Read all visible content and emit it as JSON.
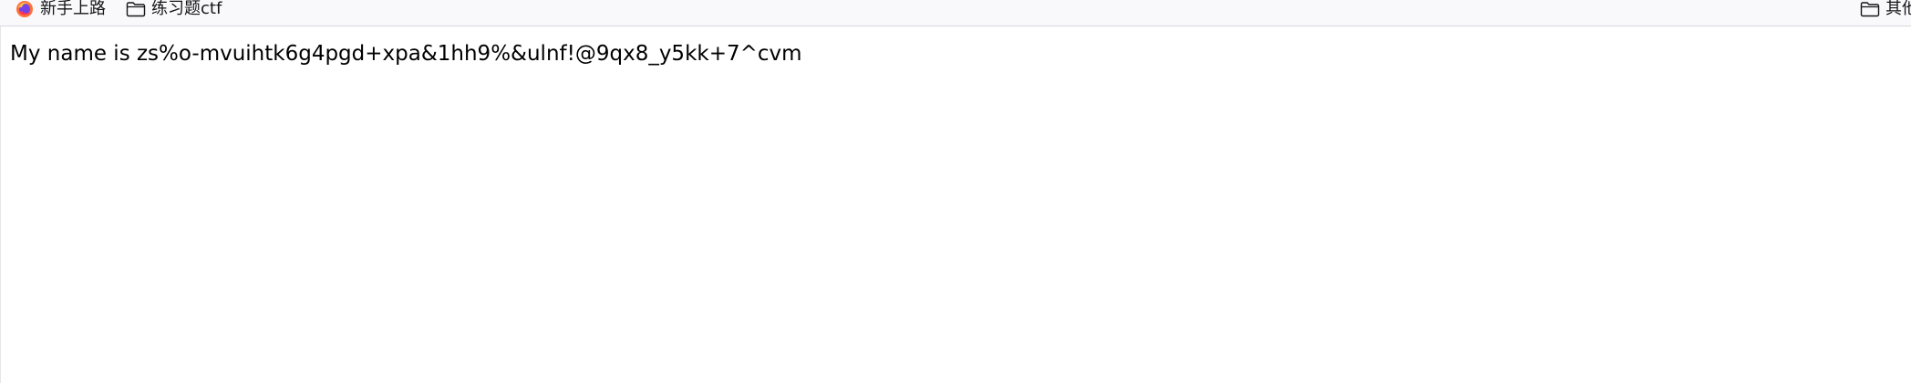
{
  "bookmarks_bar": {
    "items": [
      {
        "label": "新手上路",
        "icon": "firefox-icon"
      },
      {
        "label": "练习题ctf",
        "icon": "folder-icon"
      },
      {
        "label": "其他",
        "icon": "folder-icon"
      }
    ]
  },
  "page": {
    "text": "My name is zs%o-mvuihtk6g4pgd+xpa&1hh9%&ulnf!@9qx8_y5kk+7^cvm"
  },
  "colors": {
    "bookmarks_bar_bg": "#f9f9fb",
    "bookmarks_bar_border": "#d8d8dc",
    "page_bg": "#ffffff",
    "text": "#000000"
  }
}
